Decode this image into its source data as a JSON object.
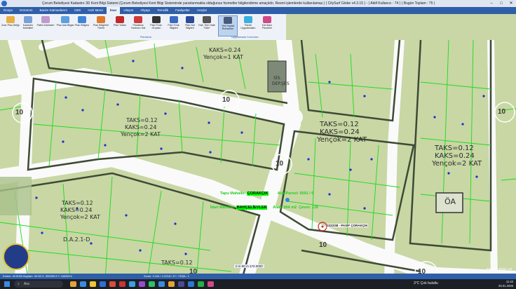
{
  "window": {
    "title": "Çorum Belediyesi Kadastro 3D Kent Bilgi Sistemi (Çorum Belediyesi Kent Bilgi Sisteminde yararlanmakta olduğunuz hizmetler bilgilendirme amaçlıdır, Resmi işlemlerde kullanılamaz.) ( CitySurf Globe v4.3.15 ) - ( Aktif Kullanıcı : 74 ) ( Bugün Toplam : 75 )",
    "controls": [
      "–",
      "□",
      "✕"
    ]
  },
  "menu": {
    "tabs": [
      "Dosya",
      "Görünüm",
      "Banim Katmanlarım",
      "CBS",
      "Hızlı Menü",
      "İmar",
      "Ulaşım",
      "Altyapı",
      "Temsilik",
      "Faaliyetler",
      "Araçlar"
    ],
    "active": "İmar"
  },
  "ribbon": {
    "buttons": [
      {
        "label": "İmar Plan Altlığı",
        "icon": "map-layer-icon",
        "color": "#e8b040"
      },
      {
        "label": "Kadastro Mahalleri",
        "icon": "cadastre-icon",
        "color": "#7aa0d8"
      },
      {
        "label": "Pafta İndeksleri",
        "icon": "index-icon",
        "color": "#c09ad0"
      },
      {
        "label": "Plan Ada Bilgisi",
        "icon": "block-icon",
        "color": "#5da0e0"
      },
      {
        "label": "Plan Bölgesi",
        "icon": "region-icon",
        "color": "#3d86d6"
      },
      {
        "label": "Plan Bölgeleri Türleri",
        "icon": "region-types-icon",
        "color": "#e07a2a"
      },
      {
        "label": "Plan Yolları",
        "icon": "road-icon",
        "color": "#c02a2a"
      },
      {
        "label": "Planlama Yardımcı Hat",
        "icon": "helper-line-icon",
        "color": "#d03a3a"
      },
      {
        "label": "Plan Fonk. Grupları",
        "icon": "function-group-icon",
        "color": "#333333"
      },
      {
        "label": "Plan Fonk. Bilgileri",
        "icon": "function-info-icon",
        "color": "#3a6ac0"
      },
      {
        "label": "Plan Not Bilgileri",
        "icon": "note-icon",
        "color": "#2a4a9a"
      },
      {
        "label": "Hızlı Tren Hattı \"Ülke\"",
        "icon": "train-icon",
        "color": "#555555"
      },
      {
        "label": "Yeni İnşaat Ruhsatları",
        "icon": "building-icon",
        "color": "#4a5a7a"
      },
      {
        "label": "Parsel Uygulamaları",
        "icon": "parcel-icon",
        "color": "#3ab0e0"
      },
      {
        "label": "Kat Alanı Parseller",
        "icon": "floor-area-icon",
        "color": "#d04a8a"
      }
    ],
    "groups": [
      "Planlama",
      "Uygulamalar Kurumları"
    ]
  },
  "map": {
    "labels": [
      "KAKS=0.24",
      "Yençok=1 KAT",
      "SİS.",
      "DEP.ŞBS",
      "TAKS=0.12",
      "KAKS=0.24",
      "Yençok=2 KAT",
      "TAKS=0.12",
      "KAKS=0.24",
      "Yençok=2 KAT",
      "TAKS=0.12",
      "KAKS=0.24",
      "Yençok=2 KAT",
      "TAKS=0.12",
      "KAKS=0.24",
      "Yençok=2 KAT",
      "D.A.2.1-D",
      "ÖA",
      "TAKS=0.12"
    ],
    "road_numbers": [
      "10",
      "10",
      "10",
      "10",
      "10",
      "10",
      "10"
    ],
    "parcel_info": {
      "tapu_mahalle_label": "Tapu Mahalle:",
      "tapu_mahalle": "ÇORAKÇIK",
      "ada_parsel_label": "Ada/Parsel:",
      "ada_parsel": "5091 / 6",
      "idari_mahalle_label": "İdari Mahalle:",
      "idari_mahalle": "BAHÇELİEVLER",
      "alan_label": "Alan:",
      "alan": "904 m2",
      "cevre_label": "Çevre:",
      "cevre": "139",
      "point_label": "2222/38 - PASİF ÇORAKÇIK"
    },
    "scale_text": "0 m   90 m   172.0000",
    "footer_right": "Pathaus Bilgin Ltd"
  },
  "status": {
    "left": "Enlem: 40.5000 Boylam: 34.95 X: 333350.9 Y: 4483224",
    "middle": "Zoom: 3.104 / 1:2218 / 47  /  YEŞİL: 1"
  },
  "taskbar": {
    "search_placeholder": "Ara",
    "weather_temp": "3°C",
    "weather_desc": "Çok bulutlu",
    "time": "11:43",
    "date": "25.01.2025"
  }
}
